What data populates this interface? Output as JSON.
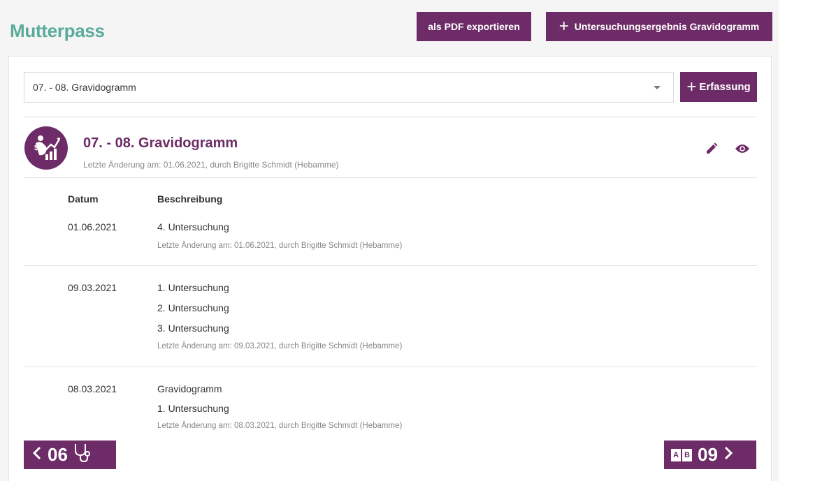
{
  "header": {
    "title": "Mutterpass",
    "pdf_button_label": "als PDF exportieren",
    "add_result_button_label": "Untersuchungsergebnis Gravidogramm"
  },
  "toolbar": {
    "selected_option": "07. - 08. Gravidogramm",
    "erfassung_button_label": "Erfassung"
  },
  "section": {
    "title": "07. - 08. Gravidogramm",
    "meta": "Letzte Änderung am: 01.06.2021, durch Brigitte Schmidt (Hebamme)"
  },
  "table": {
    "columns": [
      "Datum",
      "Beschreibung"
    ],
    "rows": [
      {
        "date": "01.06.2021",
        "lines": [
          "4. Untersuchung"
        ],
        "meta": "Letzte Änderung am: 01.06.2021, durch Brigitte Schmidt (Hebamme)"
      },
      {
        "date": "09.03.2021",
        "lines": [
          "1. Untersuchung",
          "2. Untersuchung",
          "3. Untersuchung"
        ],
        "meta": "Letzte Änderung am: 09.03.2021, durch Brigitte Schmidt (Hebamme)"
      },
      {
        "date": "08.03.2021",
        "lines": [
          "Gravidogramm",
          "1. Untersuchung"
        ],
        "meta": "Letzte Änderung am: 08.03.2021, durch Brigitte Schmidt (Hebamme)"
      }
    ]
  },
  "navigation": {
    "prev_page": "06",
    "next_page": "09",
    "ab_letters": [
      "A",
      "B"
    ]
  },
  "colors": {
    "brand_purple": "#6d2c67",
    "title_teal": "#5aab9b"
  },
  "icons": {
    "section": "pregnancy-chart-icon",
    "edit": "pencil-icon",
    "view": "eye-icon",
    "prev_arrow": "chevron-left-icon",
    "prev_symbol": "stethoscope-icon",
    "next_symbol": "ab-icon",
    "next_arrow": "chevron-right-icon"
  }
}
